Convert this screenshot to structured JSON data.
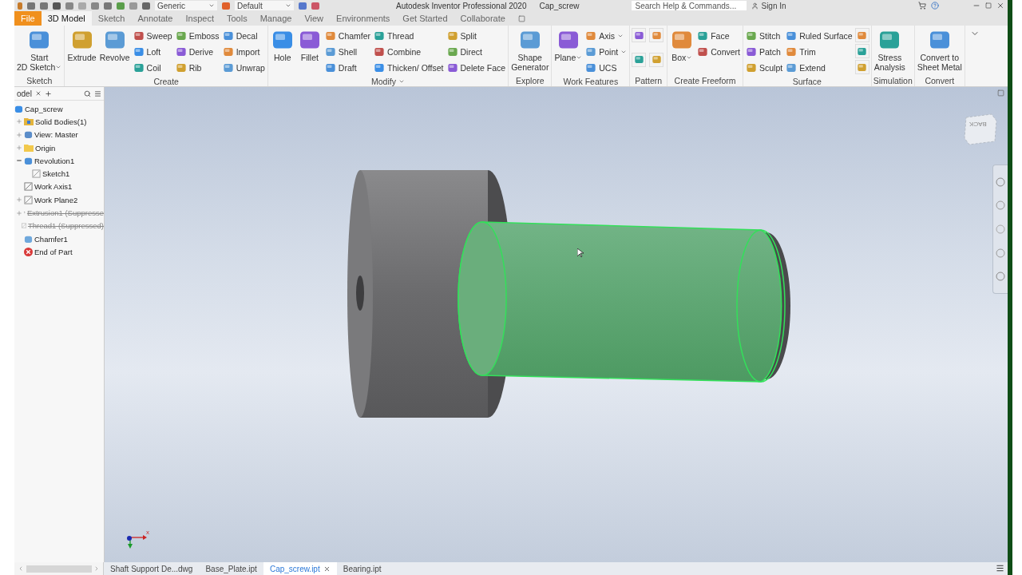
{
  "title_bar": {
    "appearance": "Generic",
    "visual_style": "Default",
    "title": "Autodesk Inventor Professional 2020",
    "document": "Cap_screw",
    "search": {
      "placeholder": "Search Help & Commands..."
    },
    "sign_in": "Sign In"
  },
  "ribbon_tabs": [
    {
      "label": "File",
      "kind": "application"
    },
    {
      "label": "3D Model",
      "kind": "tab",
      "selected": true
    },
    {
      "label": "Sketch",
      "kind": "tab",
      "selected": false
    },
    {
      "label": "Annotate",
      "kind": "tab",
      "selected": false
    },
    {
      "label": "Inspect",
      "kind": "tab",
      "selected": false
    },
    {
      "label": "Tools",
      "kind": "tab",
      "selected": false
    },
    {
      "label": "Manage",
      "kind": "tab",
      "selected": false
    },
    {
      "label": "View",
      "kind": "tab",
      "selected": false
    },
    {
      "label": "Environments",
      "kind": "tab",
      "selected": false
    },
    {
      "label": "Get Started",
      "kind": "tab",
      "selected": false
    },
    {
      "label": "Collaborate",
      "kind": "tab",
      "selected": false
    }
  ],
  "ribbon_groups": [
    {
      "title": "Sketch",
      "menu": false,
      "columns": [
        {
          "kind": "large",
          "label_lines": [
            "Start",
            "2D Sketch"
          ],
          "menu": true
        }
      ]
    },
    {
      "title": "Create",
      "menu": false,
      "columns": [
        {
          "kind": "large",
          "label_lines": [
            "Extrude"
          ],
          "menu": false
        },
        {
          "kind": "large",
          "label_lines": [
            "Revolve"
          ],
          "menu": false
        },
        {
          "kind": "stack",
          "items": [
            {
              "label": "Sweep",
              "menu": false
            },
            {
              "label": "Loft",
              "menu": false
            },
            {
              "label": "Coil",
              "menu": false
            }
          ]
        },
        {
          "kind": "stack",
          "items": [
            {
              "label": "Emboss",
              "menu": false
            },
            {
              "label": "Derive",
              "menu": false
            },
            {
              "label": "Rib",
              "menu": false
            }
          ]
        },
        {
          "kind": "stack",
          "items": [
            {
              "label": "Decal",
              "menu": false
            },
            {
              "label": "Import",
              "menu": false
            },
            {
              "label": "Unwrap",
              "menu": false
            }
          ]
        }
      ]
    },
    {
      "title": "Modify",
      "menu": true,
      "columns": [
        {
          "kind": "large",
          "label_lines": [
            "Hole"
          ],
          "menu": false
        },
        {
          "kind": "large",
          "label_lines": [
            "Fillet"
          ],
          "menu": false
        },
        {
          "kind": "stack",
          "items": [
            {
              "label": "Chamfer",
              "menu": false
            },
            {
              "label": "Shell",
              "menu": false
            },
            {
              "label": "Draft",
              "menu": false
            }
          ]
        },
        {
          "kind": "stack",
          "items": [
            {
              "label": "Thread",
              "menu": false
            },
            {
              "label": "Combine",
              "menu": false
            },
            {
              "label": "Thicken/ Offset",
              "menu": false
            }
          ]
        },
        {
          "kind": "stack",
          "items": [
            {
              "label": "Split",
              "menu": false
            },
            {
              "label": "Direct",
              "menu": false
            },
            {
              "label": "Delete Face",
              "menu": false
            }
          ]
        }
      ]
    },
    {
      "title": "Explore",
      "menu": false,
      "columns": [
        {
          "kind": "large",
          "label_lines": [
            "Shape",
            "Generator"
          ],
          "menu": false
        }
      ]
    },
    {
      "title": "Work Features",
      "menu": false,
      "columns": [
        {
          "kind": "large",
          "label_lines": [
            "Plane"
          ],
          "menu": true
        },
        {
          "kind": "stack",
          "items": [
            {
              "label": "Axis",
              "menu": true
            },
            {
              "label": "Point",
              "menu": true
            },
            {
              "label": "UCS",
              "menu": false
            }
          ]
        }
      ]
    },
    {
      "title": "Pattern",
      "menu": false,
      "columns": [
        {
          "kind": "icon_grid"
        }
      ]
    },
    {
      "title": "Create Freeform",
      "menu": false,
      "columns": [
        {
          "kind": "large",
          "label_lines": [
            "Box"
          ],
          "menu": true
        },
        {
          "kind": "stack",
          "items": [
            {
              "label": "Face",
              "menu": false
            },
            {
              "label": "Convert",
              "menu": false
            }
          ]
        }
      ]
    },
    {
      "title": "Surface",
      "menu": false,
      "columns": [
        {
          "kind": "stack",
          "items": [
            {
              "label": "Stitch",
              "menu": false
            },
            {
              "label": "Patch",
              "menu": false
            },
            {
              "label": "Sculpt",
              "menu": false
            }
          ]
        },
        {
          "kind": "stack",
          "items": [
            {
              "label": "Ruled Surface",
              "menu": false
            },
            {
              "label": "Trim",
              "menu": false
            },
            {
              "label": "Extend",
              "menu": false
            }
          ]
        },
        {
          "kind": "icon_column"
        }
      ]
    },
    {
      "title": "Simulation",
      "menu": false,
      "columns": [
        {
          "kind": "large",
          "label_lines": [
            "Stress",
            "Analysis"
          ],
          "menu": false
        }
      ]
    },
    {
      "title": "Convert",
      "menu": false,
      "columns": [
        {
          "kind": "large",
          "label_lines": [
            "Convert to",
            "Sheet Metal"
          ],
          "menu": false
        }
      ]
    }
  ],
  "browser": {
    "tab": "odel",
    "tree": {
      "label": "Cap_screw",
      "kind": "part",
      "suppressed": false,
      "children": [
        {
          "label": "Solid Bodies(1)",
          "kind": "bodies",
          "suppressed": false,
          "expanded": false
        },
        {
          "label": "View: Master",
          "kind": "view",
          "suppressed": false,
          "expanded": false
        },
        {
          "label": "Origin",
          "kind": "folder",
          "suppressed": false,
          "expanded": false
        },
        {
          "label": "Revolution1",
          "kind": "revolve",
          "suppressed": false,
          "expanded": true,
          "children": [
            {
              "label": "Sketch1",
              "kind": "sketch",
              "suppressed": false
            }
          ]
        },
        {
          "label": "Work Axis1",
          "kind": "axis",
          "suppressed": false
        },
        {
          "label": "Work Plane2",
          "kind": "plane",
          "suppressed": false,
          "expanded": false
        },
        {
          "label": "Extrusion1 (Suppresse",
          "kind": "extrude",
          "suppressed": true,
          "expanded": false
        },
        {
          "label": "Thread1 (Suppressed)",
          "kind": "thread",
          "suppressed": true
        },
        {
          "label": "Chamfer1",
          "kind": "chamfer",
          "suppressed": false
        },
        {
          "label": "End of Part",
          "kind": "end",
          "suppressed": false
        }
      ]
    }
  },
  "viewport": {
    "view_cube": "BACK",
    "triad_x": "x"
  },
  "document_tabs": [
    {
      "label": "Shaft Support De...dwg",
      "selected": false,
      "closable": false
    },
    {
      "label": "Base_Plate.ipt",
      "selected": false,
      "closable": false
    },
    {
      "label": "Cap_screw.ipt",
      "selected": true,
      "closable": true
    },
    {
      "label": "Bearing.ipt",
      "selected": false,
      "closable": false
    }
  ]
}
